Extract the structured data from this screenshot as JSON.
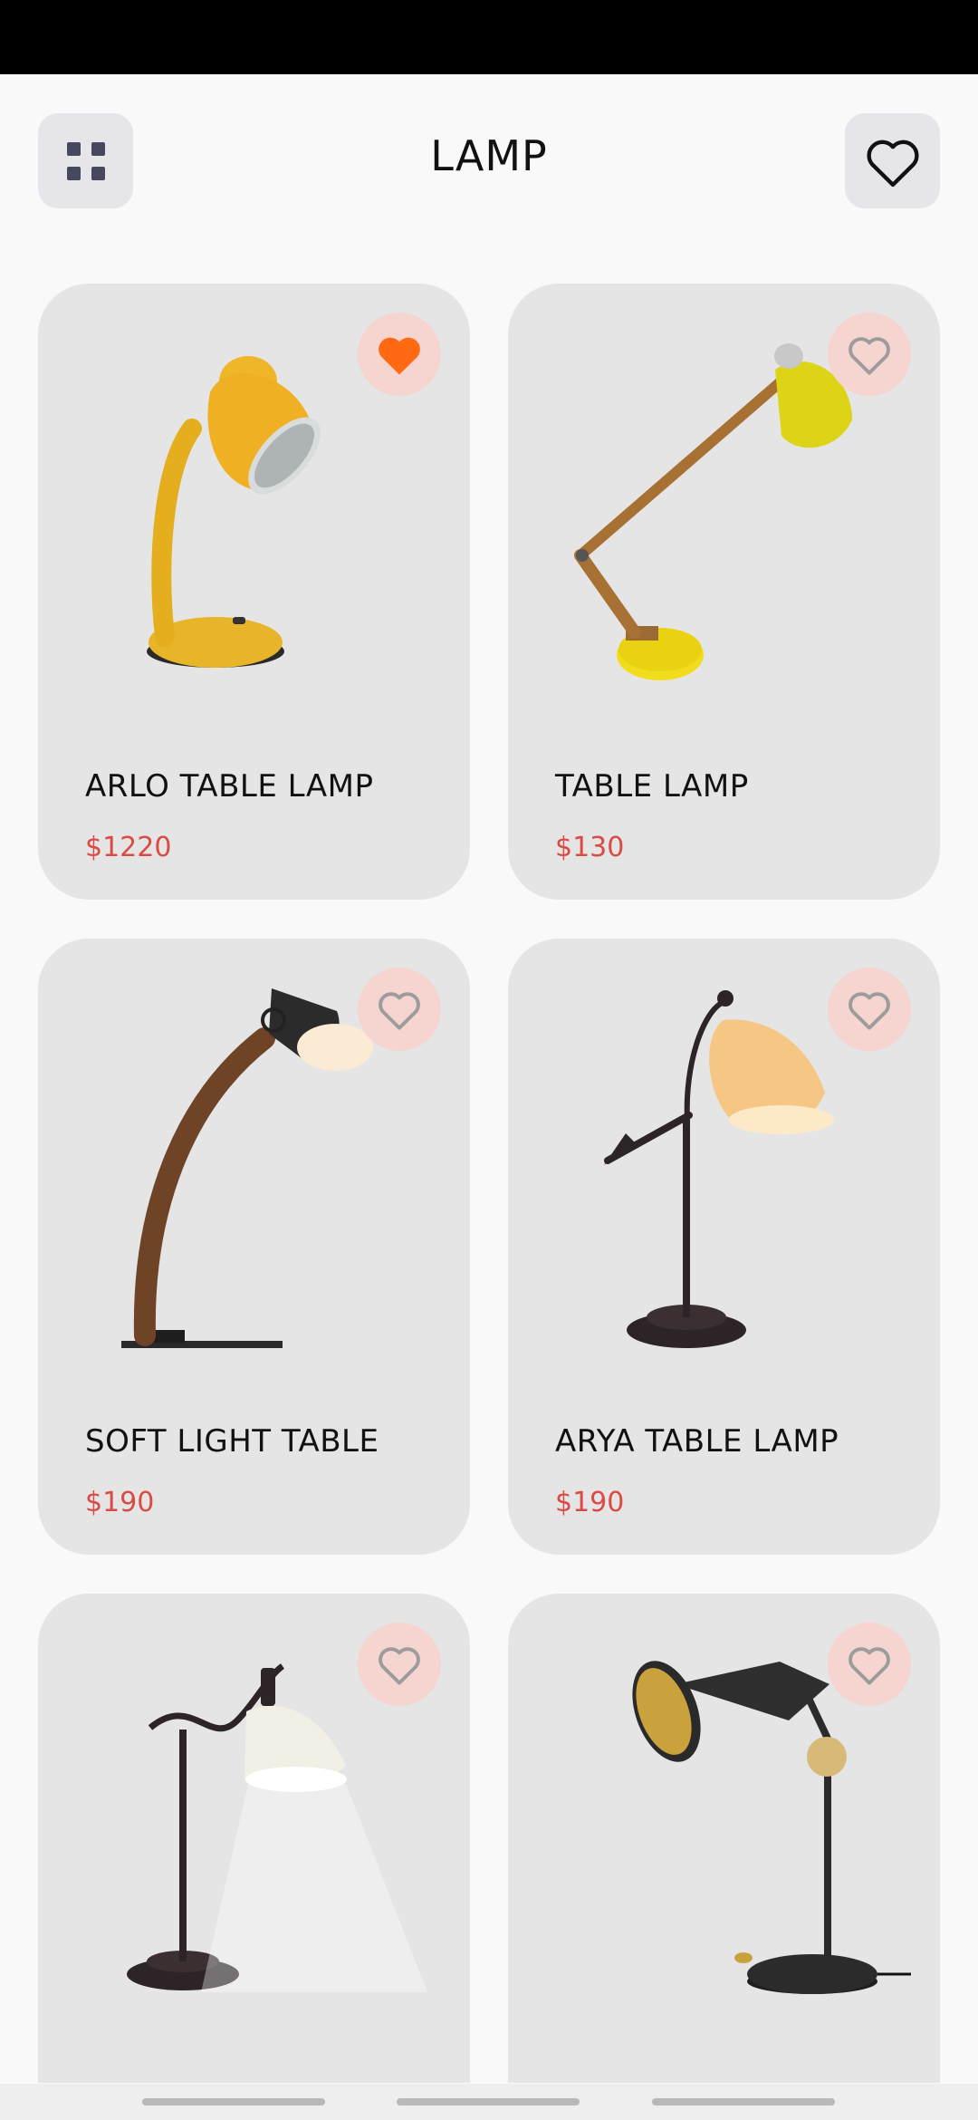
{
  "header": {
    "title": "LAMP",
    "menu_icon": "grid-icon",
    "favorites_icon": "heart-outline-icon"
  },
  "colors": {
    "card_bg": "#e5e5e5",
    "fav_bg": "#f6d4d0",
    "fav_active": "#ff6a13",
    "price": "#d94c45"
  },
  "products": [
    {
      "name": "ARLO TABLE LAMP",
      "price": "$1220",
      "favorite": true
    },
    {
      "name": "TABLE LAMP",
      "price": "$130",
      "favorite": false
    },
    {
      "name": "SOFT LIGHT TABLE",
      "price": "$190",
      "favorite": false
    },
    {
      "name": "ARYA TABLE LAMP",
      "price": "$190",
      "favorite": false
    },
    {
      "name": "",
      "price": "",
      "favorite": false
    },
    {
      "name": "",
      "price": "",
      "favorite": false
    }
  ]
}
